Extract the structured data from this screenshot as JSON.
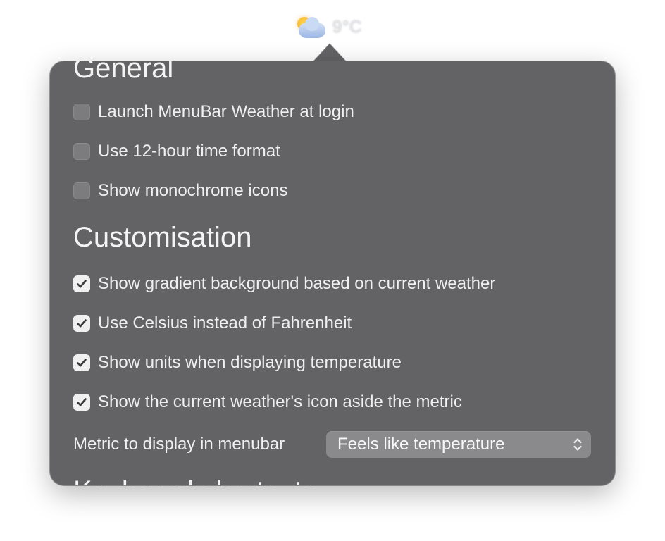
{
  "menubar": {
    "temperature": "9°C",
    "icon": "partly-cloudy-day-icon"
  },
  "popover": {
    "general": {
      "title": "General",
      "options": [
        {
          "label": "Launch MenuBar Weather at login",
          "checked": false
        },
        {
          "label": "Use 12-hour time format",
          "checked": false
        },
        {
          "label": "Show monochrome icons",
          "checked": false
        }
      ]
    },
    "customisation": {
      "title": "Customisation",
      "options": [
        {
          "label": "Show gradient background based on current weather",
          "checked": true
        },
        {
          "label": "Use Celsius instead of Fahrenheit",
          "checked": true
        },
        {
          "label": "Show units when displaying temperature",
          "checked": true
        },
        {
          "label": "Show the current weather's icon aside the metric",
          "checked": true
        }
      ],
      "metric": {
        "label": "Metric to display in menubar",
        "selected": "Feels like temperature"
      }
    },
    "next_section_title": "Keyboard shortcuts"
  },
  "colors": {
    "popover_bg": "#636365",
    "checkbox_checked": "#f0f0f0",
    "checkbox_unchecked": "#7c7c7e",
    "select_bg": "#8a8a8c"
  }
}
